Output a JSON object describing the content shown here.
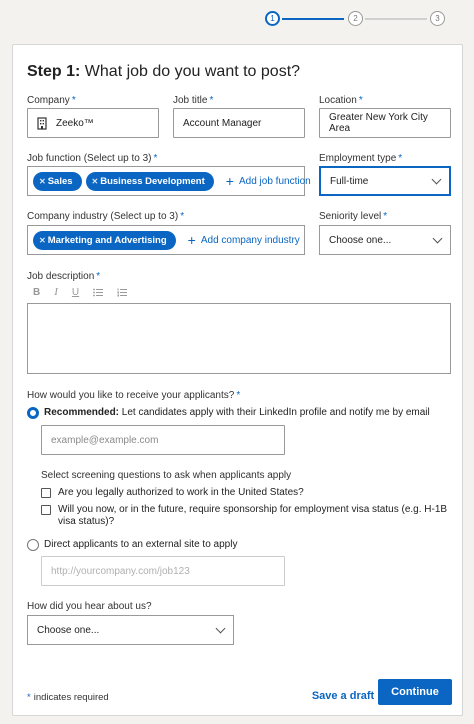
{
  "stepper": {
    "steps": [
      "1",
      "2",
      "3"
    ],
    "current": 1,
    "accent": "#0a66c2"
  },
  "form": {
    "title_prefix": "Step 1:",
    "title_text": "What job do you want to post?",
    "required_mark": "*",
    "company": {
      "label": "Company",
      "value": "Zeeko™",
      "icon": "building-icon"
    },
    "job_title": {
      "label": "Job title",
      "value": "Account Manager"
    },
    "location": {
      "label": "Location",
      "value": "Greater New York City Area"
    },
    "job_function": {
      "label": "Job function (Select up to 3)",
      "pills": [
        "Sales",
        "Business Development"
      ],
      "add_label": "Add job function"
    },
    "employment_type": {
      "label": "Employment type",
      "value": "Full-time"
    },
    "company_industry": {
      "label": "Company industry (Select up to 3)",
      "pills": [
        "Marketing and Advertising"
      ],
      "add_label": "Add company industry"
    },
    "seniority_level": {
      "label": "Seniority level",
      "value": "Choose one..."
    },
    "job_description": {
      "label": "Job description",
      "toolbar": [
        "B",
        "I",
        "U",
        "bulleted-list-icon",
        "numbered-list-icon"
      ]
    },
    "receive_applicants": {
      "label": "How would you like to receive your applicants?",
      "option_linkedin_bold": "Recommended:",
      "option_linkedin_text": "Let candidates apply with their LinkedIn profile and notify me by email",
      "email_placeholder": "example@example.com",
      "screening_label": "Select screening questions to ask when applicants apply",
      "screening_q1": "Are you legally authorized to work in the United States?",
      "screening_q2": "Will you now, or in the future, require sponsorship for employment visa status (e.g. H-1B visa status)?",
      "option_external": "Direct applicants to an external site to apply",
      "url_placeholder": "http://yourcompany.com/job123"
    },
    "hear_about": {
      "label": "How did you hear about us?",
      "value": "Choose one..."
    },
    "footer": {
      "required_note": "indicates required",
      "save_draft": "Save a draft",
      "continue": "Continue"
    }
  }
}
